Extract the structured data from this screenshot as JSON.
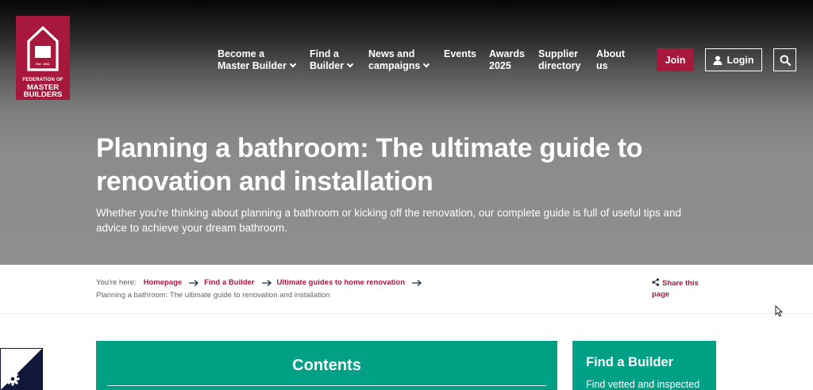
{
  "brand": {
    "logo_est": "Est. 1941",
    "logo_line1": "FEDERATION OF",
    "logo_line2": "MASTER",
    "logo_line3": "BUILDERS",
    "color": "#a6193c"
  },
  "nav": {
    "items": [
      {
        "line1": "Become a",
        "line2": "Master Builder",
        "dropdown": true
      },
      {
        "line1": "Find a",
        "line2": "Builder",
        "dropdown": true
      },
      {
        "line1": "News and",
        "line2": "campaigns",
        "dropdown": true
      },
      {
        "line1": "Events",
        "line2": "",
        "dropdown": false
      },
      {
        "line1": "Awards",
        "line2": "2025",
        "dropdown": false
      },
      {
        "line1": "Supplier",
        "line2": "directory",
        "dropdown": false
      },
      {
        "line1": "About",
        "line2": "us",
        "dropdown": false
      }
    ],
    "join_label": "Join",
    "login_label": "Login",
    "search_icon": "search-icon",
    "user_icon": "user-icon"
  },
  "hero": {
    "title_line1": "Planning a bathroom: The ultimate guide to",
    "title_line2": "renovation and installation",
    "subtitle_line1": "Whether you're thinking about planning a bathroom or kicking off the renovation, our complete guide is full of useful tips and",
    "subtitle_line2": "advice to achieve your dream bathroom."
  },
  "breadcrumb": {
    "prefix": "You're here:",
    "links": [
      "Homepage",
      "Find a Builder",
      "Ultimate guides to home renovation"
    ],
    "current": "Planning a bathroom: The ultimate guide to renovation and installation"
  },
  "share": {
    "line1": "Share this",
    "line2": "page",
    "icon": "share-icon"
  },
  "contents": {
    "title": "Contents",
    "color": "#00a087"
  },
  "find_builder": {
    "title": "Find a Builder",
    "text": "Find vetted and inspected"
  },
  "cookie": {
    "icon": "gear-icon"
  }
}
